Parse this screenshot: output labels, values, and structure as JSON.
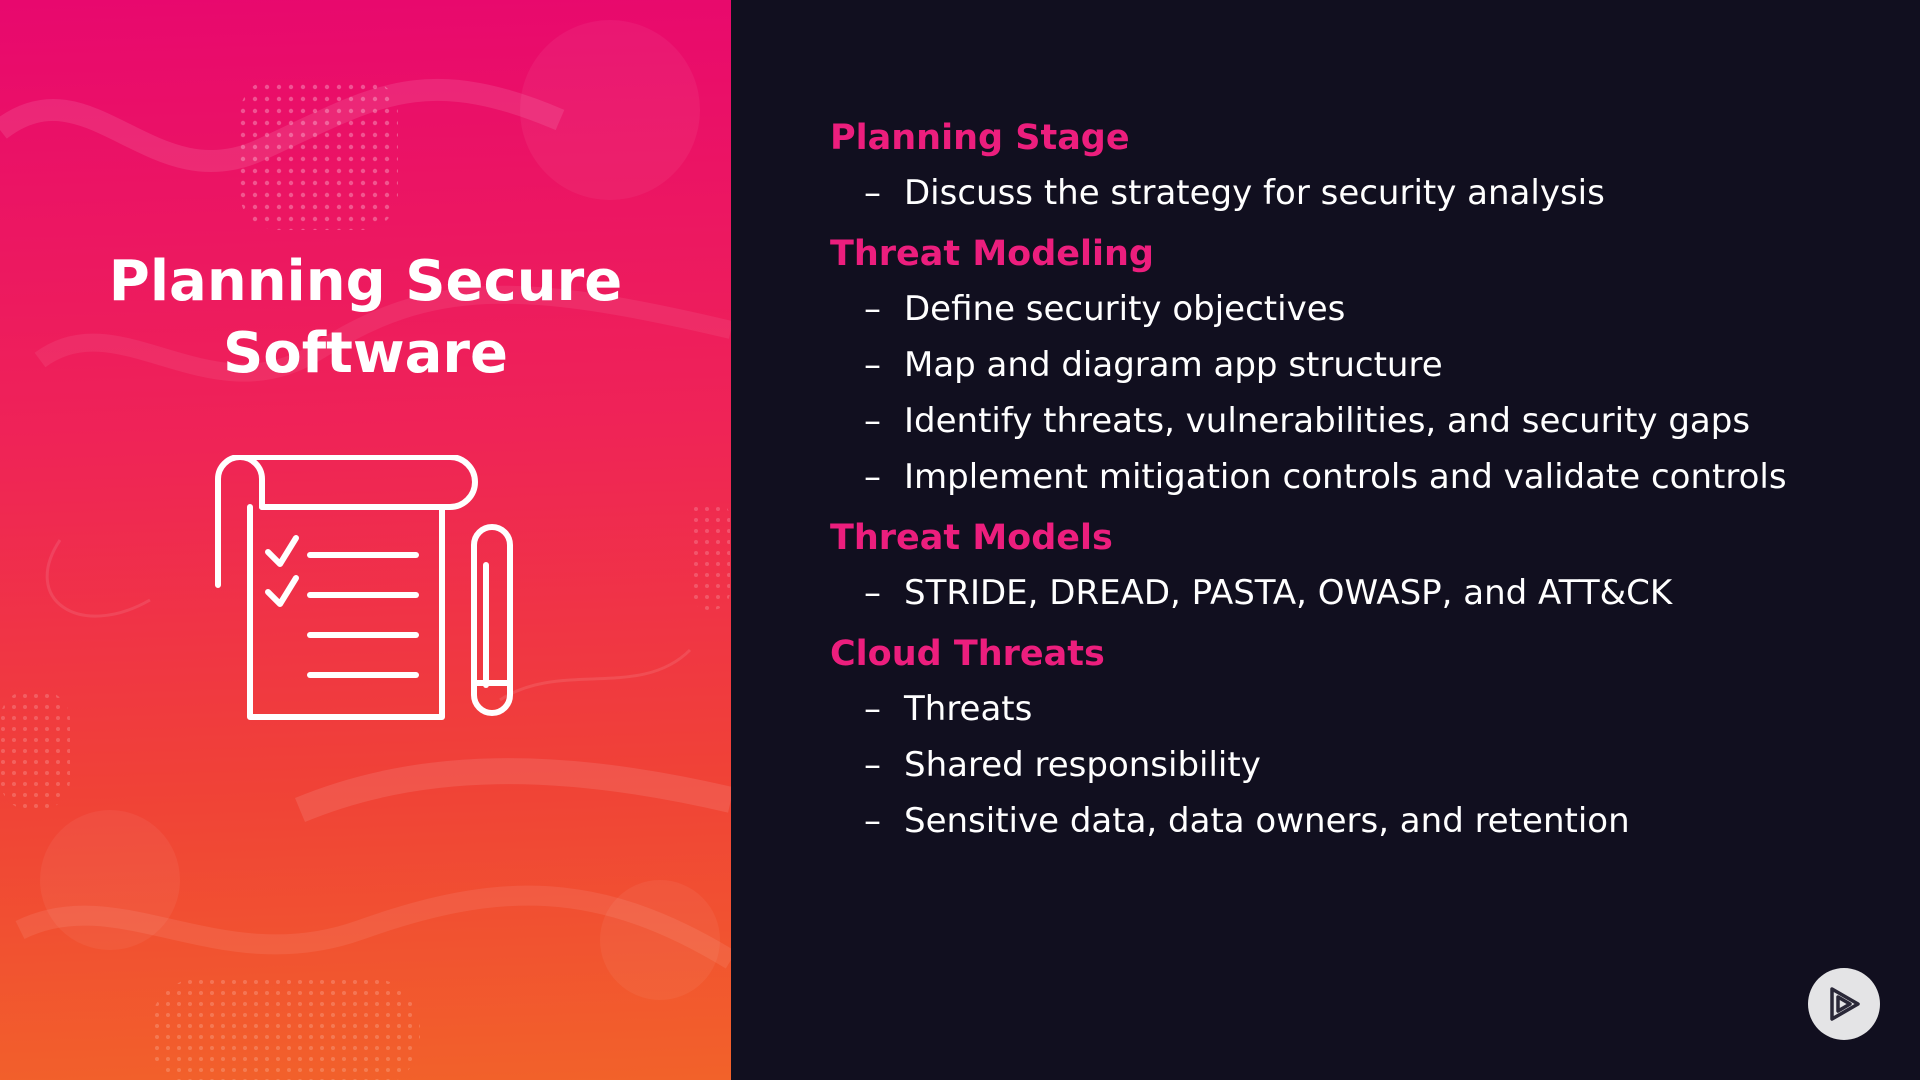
{
  "slide": {
    "title_line1": "Planning Secure",
    "title_line2": "Software"
  },
  "sections": [
    {
      "heading": "Planning Stage",
      "items": [
        "Discuss the strategy for security analysis"
      ]
    },
    {
      "heading": "Threat Modeling",
      "items": [
        "Define security objectives",
        "Map and diagram app structure",
        "Identify threats, vulnerabilities, and security gaps",
        "Implement mitigation controls and validate controls"
      ]
    },
    {
      "heading": "Threat Models",
      "items": [
        "STRIDE, DREAD, PASTA, OWASP, and ATT&CK"
      ]
    },
    {
      "heading": "Cloud Threats",
      "items": [
        "Threats",
        "Shared responsibility",
        "Sensitive data, data owners, and retention"
      ]
    }
  ],
  "bullet_symbol": "–",
  "icons": {
    "illustration": "checklist-pen-icon",
    "corner_button": "play-logo-icon"
  },
  "colors": {
    "accent_heading": "#ec1e7d",
    "background_dark": "#110f1f",
    "gradient_top": "#e8086e",
    "gradient_bottom": "#f2622a",
    "text": "#ffffff"
  }
}
